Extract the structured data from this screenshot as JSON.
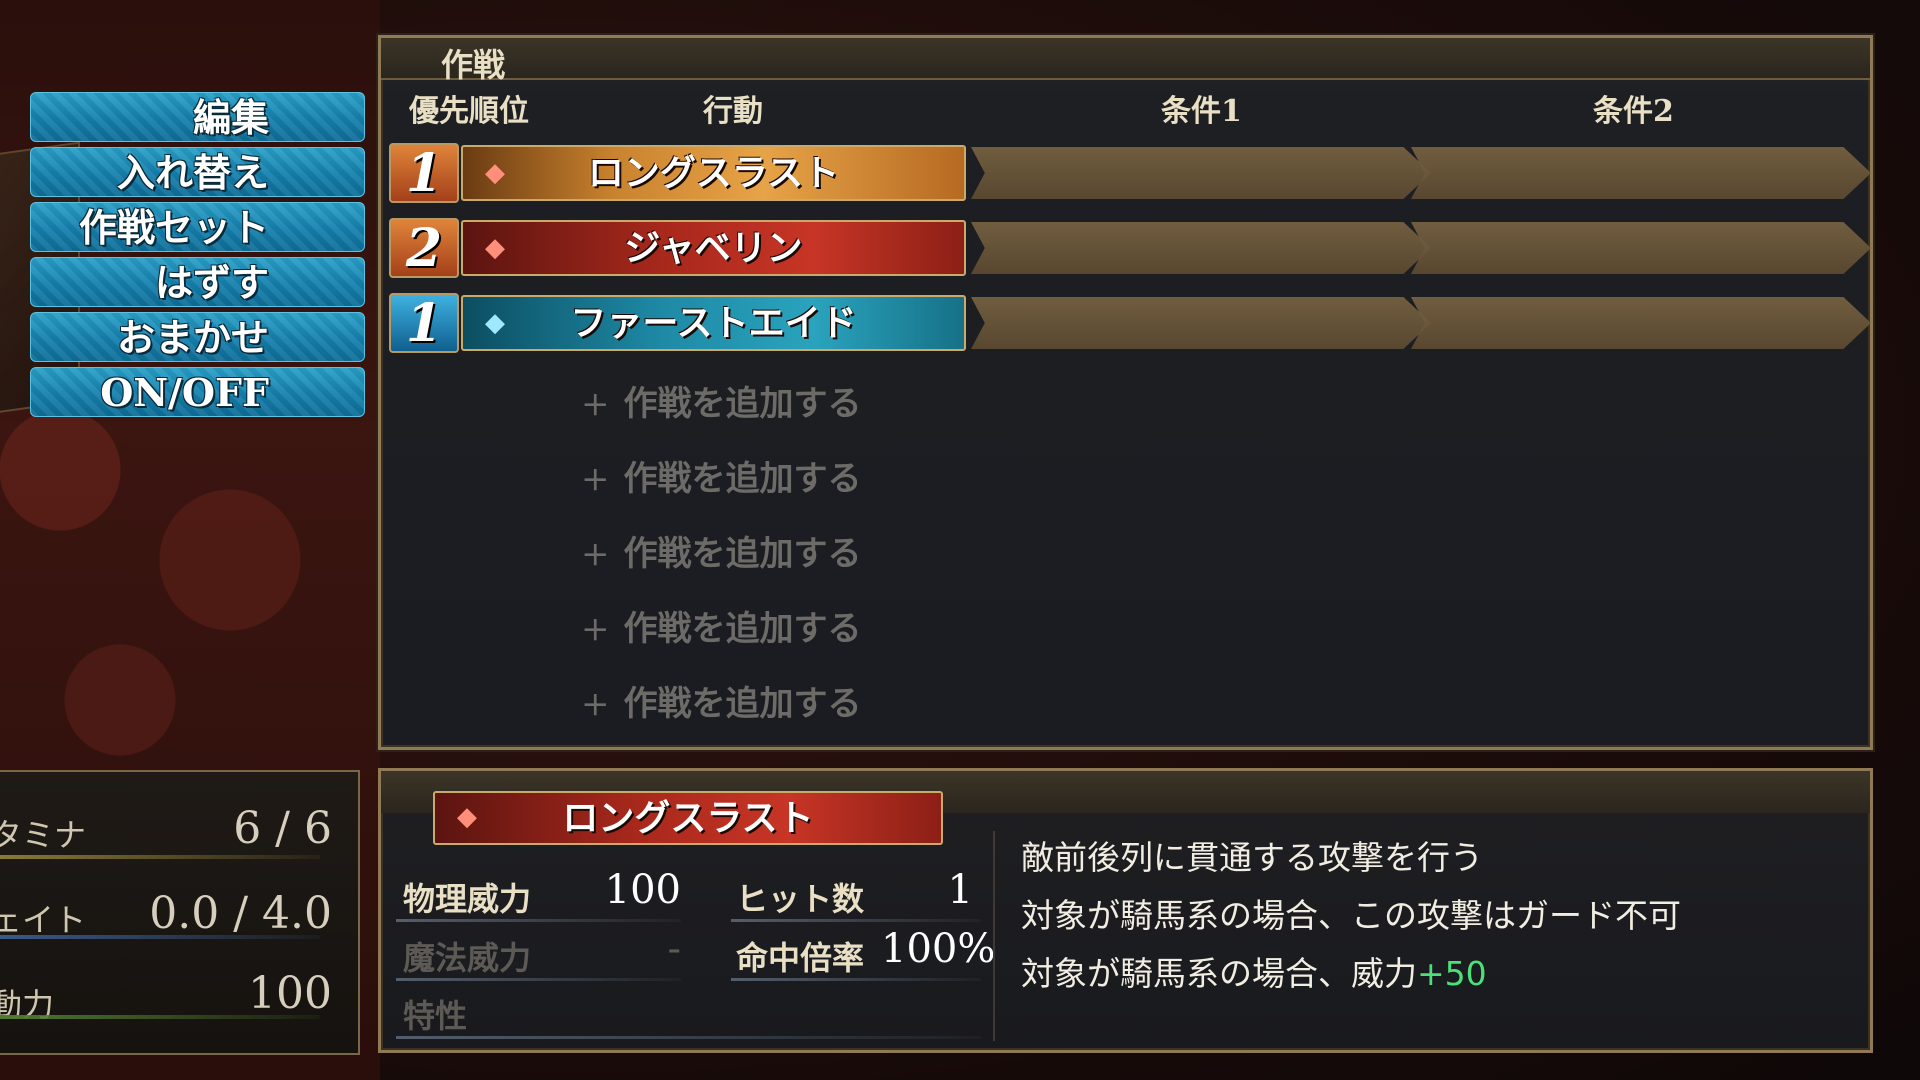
{
  "menu": {
    "items": [
      {
        "label": "編集"
      },
      {
        "label": "入れ替え"
      },
      {
        "label": "作戦セット"
      },
      {
        "label": "はずす"
      },
      {
        "label": "おまかせ"
      },
      {
        "label": "ON/OFF"
      }
    ]
  },
  "tactics": {
    "title": "作戦",
    "headers": {
      "priority": "優先順位",
      "action": "行動",
      "cond1": "条件1",
      "cond2": "条件2"
    },
    "rows": [
      {
        "priority": "1",
        "action": "ロングスラスト",
        "gem": "red-gem-icon",
        "style": "gold"
      },
      {
        "priority": "2",
        "action": "ジャベリン",
        "gem": "red-gem-icon",
        "style": "red"
      },
      {
        "priority": "1",
        "action": "ファーストエイド",
        "gem": "blue-gem-icon",
        "style": "teal"
      }
    ],
    "add_slots": [
      {
        "label": "作戦を追加する"
      },
      {
        "label": "作戦を追加する"
      },
      {
        "label": "作戦を追加する"
      },
      {
        "label": "作戦を追加する"
      },
      {
        "label": "作戦を追加する"
      }
    ]
  },
  "detail": {
    "action": "ロングスラスト",
    "phys_label": "物理威力",
    "phys_value": "100",
    "hits_label": "ヒット数",
    "hits_value": "1",
    "magic_label": "魔法威力",
    "magic_value": "-",
    "accuracy_label": "命中倍率",
    "accuracy_value": "100%",
    "trait_label": "特性",
    "desc_line1": "敵前後列に貫通する攻撃を行う",
    "desc_line2": "対象が騎馬系の場合、この攻撃はガード不可",
    "desc_line3_prefix": "対象が騎馬系の場合、威力",
    "desc_line3_highlight": "+50"
  },
  "side_stats": {
    "stamina_label": "タミナ",
    "stamina_value": "6 / 6",
    "weight_label": "ェイト",
    "weight_value": "0.0 / 4.0",
    "action_label": "動力",
    "action_value": "100"
  },
  "colors": {
    "menu_blue": "#1580ad",
    "highlight_green": "#4be07a",
    "frame_gold": "#8f7a55"
  }
}
